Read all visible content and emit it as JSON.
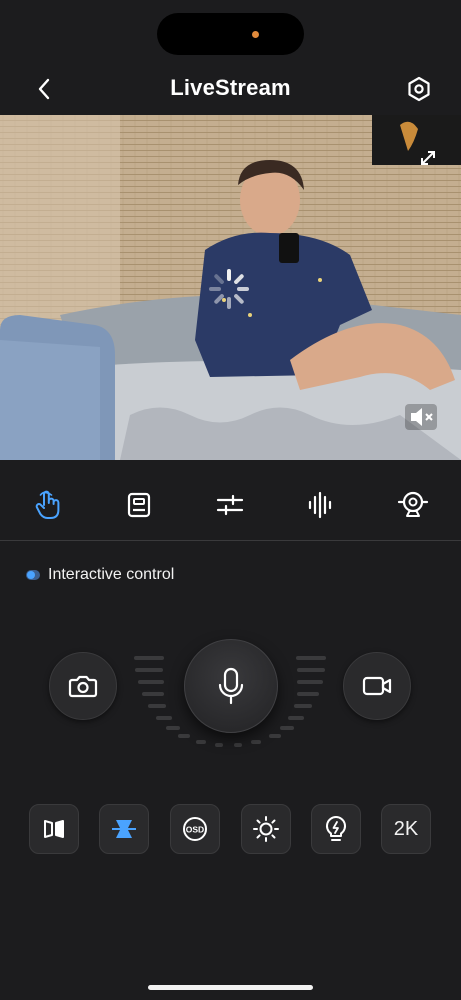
{
  "app": {
    "title": "LiveStream"
  },
  "header": {
    "back_icon": "chevron-left-icon",
    "settings_icon": "hexagon-settings-icon"
  },
  "video": {
    "expand_icon": "expand-arrows-icon",
    "loading_icon": "spinner-icon",
    "mute_icon": "speaker-muted-icon"
  },
  "toolbar": {
    "items": [
      {
        "name": "interactive-control",
        "icon": "hand-pointer-icon",
        "active": true
      },
      {
        "name": "storage",
        "icon": "sd-card-icon",
        "active": false
      },
      {
        "name": "adjust",
        "icon": "sliders-icon",
        "active": false
      },
      {
        "name": "audio",
        "icon": "sound-wave-icon",
        "active": false
      },
      {
        "name": "ptz",
        "icon": "webcam-icon",
        "active": false
      }
    ]
  },
  "section": {
    "label": "Interactive control"
  },
  "controls": {
    "snapshot_icon": "camera-icon",
    "talk_icon": "microphone-icon",
    "record_icon": "video-camera-icon"
  },
  "quick_actions": [
    {
      "name": "flip",
      "icon": "mirror-flip-icon",
      "active": false
    },
    {
      "name": "night",
      "icon": "hourglass-icon",
      "active": true
    },
    {
      "name": "osd",
      "label": "OSD",
      "active": false
    },
    {
      "name": "brightness",
      "icon": "sun-icon",
      "active": false
    },
    {
      "name": "light",
      "icon": "lightbulb-icon",
      "active": false
    },
    {
      "name": "resolution",
      "label": "2K",
      "active": false
    }
  ],
  "colors": {
    "background": "#1c1c1e",
    "accent": "#4aa3ff",
    "indicator_dot": "#e08a3c"
  }
}
